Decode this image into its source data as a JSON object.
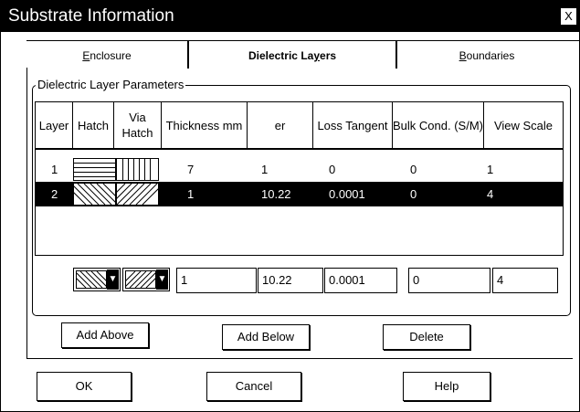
{
  "window": {
    "title": "Substrate Information",
    "close_glyph": "X"
  },
  "tabs": [
    {
      "label": "Enclosure",
      "accel": "E",
      "rest": "nclosure",
      "active": false
    },
    {
      "label": "Dielectric Layers",
      "pre": "Dielectric La",
      "accel": "y",
      "post": "ers",
      "active": true
    },
    {
      "label": "Boundaries",
      "accel": "B",
      "rest": "oundaries",
      "active": false
    }
  ],
  "group": {
    "title": "Dielectric Layer Parameters"
  },
  "table": {
    "columns": [
      "Layer",
      "Hatch",
      "Via Hatch",
      "Thickness mm",
      "er",
      "Loss Tangent",
      "Bulk Cond. (S/M)",
      "View Scale"
    ],
    "rows": [
      {
        "layer": "1",
        "thickness": "7",
        "er": "1",
        "loss": "0",
        "bulk": "0",
        "scale": "1",
        "hatch": "horizontal-lines",
        "via": "vertical-lines",
        "selected": false
      },
      {
        "layer": "2",
        "thickness": "1",
        "er": "10.22",
        "loss": "0.0001",
        "bulk": "0",
        "scale": "4",
        "hatch": "diagonal-back",
        "via": "diagonal-forward",
        "selected": true
      }
    ]
  },
  "editor": {
    "hatch_select": "diagonal-back",
    "via_select": "diagonal-forward",
    "thickness": "1",
    "er": "10.22",
    "loss": "0.0001",
    "bulk": "0",
    "scale": "4"
  },
  "buttons": {
    "add_above": "Add Above",
    "add_below": "Add Below",
    "delete": "Delete",
    "ok": "OK",
    "cancel": "Cancel",
    "help": "Help"
  }
}
